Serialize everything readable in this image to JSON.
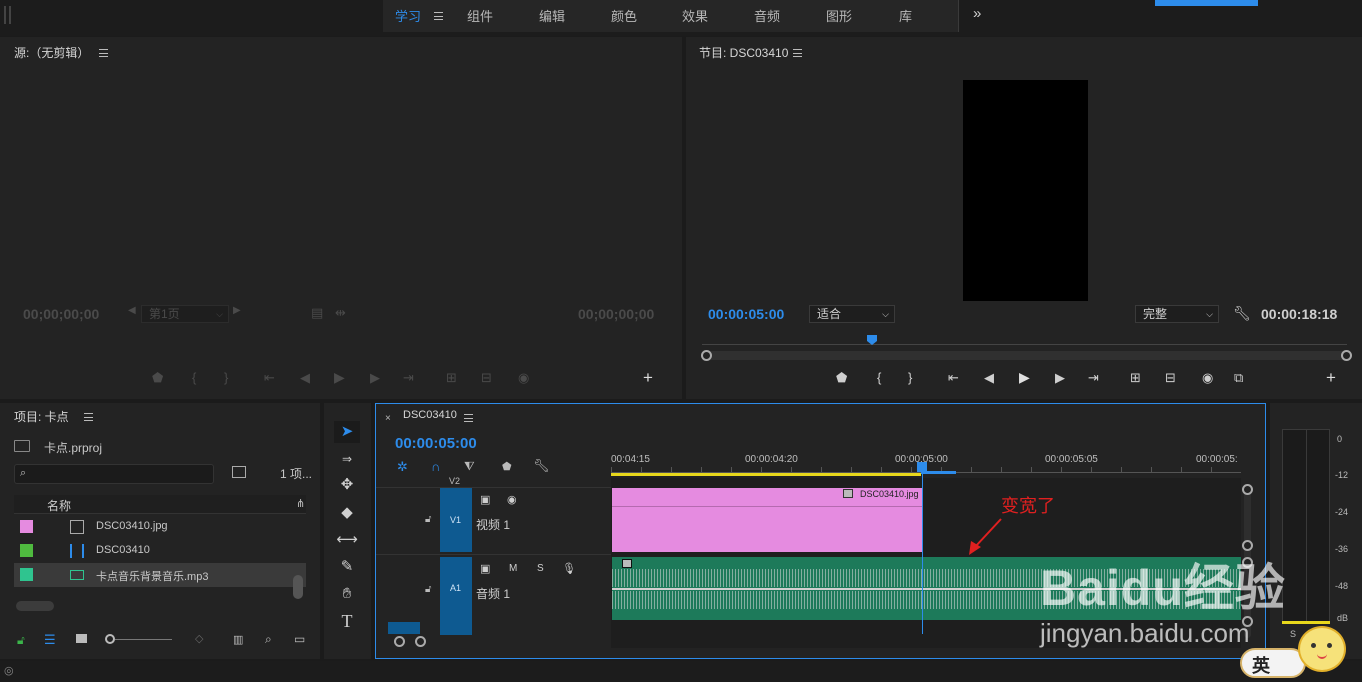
{
  "workspace": {
    "tabs": [
      "学习",
      "组件",
      "编辑",
      "颜色",
      "效果",
      "音频",
      "图形",
      "库"
    ],
    "active": "学习",
    "more": "»"
  },
  "source": {
    "title": "源:（无剪辑）",
    "tc_left": "00;00;00;00",
    "tc_right": "00;00;00;00",
    "page_select": "第1页"
  },
  "program": {
    "title": "节目: DSC03410",
    "tc_current": "00:00:05:00",
    "tc_duration": "00:00:18:18",
    "fit_select": "适合",
    "quality_select": "完整"
  },
  "project": {
    "title": "项目: 卡点",
    "file": "卡点.prproj",
    "count": "1 项...",
    "column_name": "名称",
    "items": [
      {
        "name": "DSC03410.jpg",
        "color": "#e58be0",
        "icon": "image-file-icon"
      },
      {
        "name": "DSC03410",
        "color": "#4fba3f",
        "icon": "sequence-icon"
      },
      {
        "name": "卡点音乐背景音乐.mp3",
        "color": "#2fc48f",
        "icon": "audio-file-icon"
      }
    ]
  },
  "timeline": {
    "sequence_name": "DSC03410",
    "timecode": "00:00:05:00",
    "ruler": [
      "00:04:15",
      "00:00:04:20",
      "00:00:05:00",
      "00:00:05:05",
      "00:00:05:"
    ],
    "v2_label": "V2",
    "v1_label": "V1",
    "v1_name": "视频 1",
    "a1_label": "A1",
    "a1_name": "音频 1",
    "m_label": "M",
    "s_label": "S",
    "clip_name": "DSC03410.jpg"
  },
  "meter": {
    "scale": [
      "0",
      "-12",
      "-24",
      "-36",
      "-48"
    ],
    "unit": "dB",
    "s_label": "S"
  },
  "annotation": "变宽了",
  "watermark": "Baidu经验",
  "watermark_url": "jingyan.baidu.com",
  "ime": "英"
}
